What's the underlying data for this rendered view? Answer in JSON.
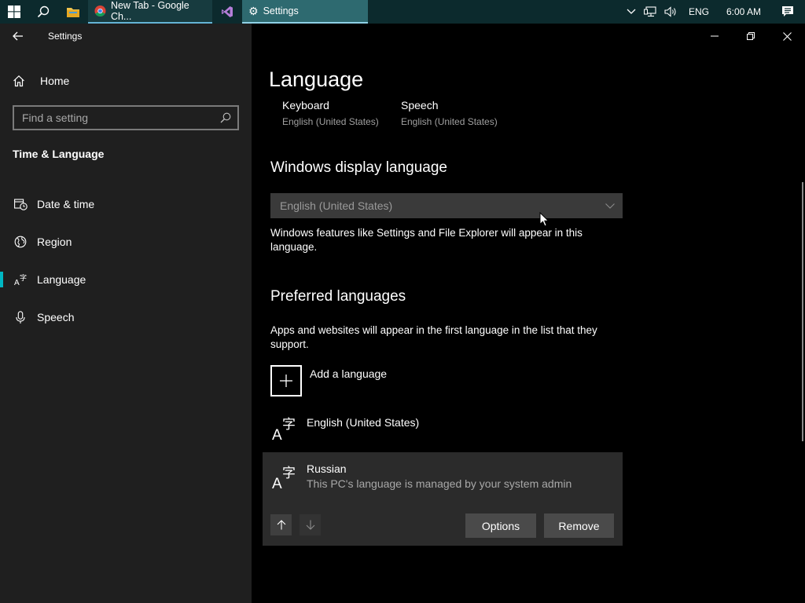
{
  "taskbar": {
    "chrome_label": "New Tab - Google Ch...",
    "settings_label": "Settings",
    "tray": {
      "language": "ENG",
      "time": "6:00 AM"
    }
  },
  "app": {
    "title": "Settings"
  },
  "nav": {
    "home_label": "Home",
    "section_title": "Time & Language",
    "items": [
      {
        "label": "Date & time",
        "icon": "calendar-clock-icon"
      },
      {
        "label": "Region",
        "icon": "globe-icon"
      },
      {
        "label": "Language",
        "icon": "language-icon",
        "active": true
      },
      {
        "label": "Speech",
        "icon": "microphone-icon"
      }
    ]
  },
  "search": {
    "placeholder": "Find a setting"
  },
  "page": {
    "title": "Language",
    "quick": {
      "keyboard": {
        "label": "Keyboard",
        "value": "English (United States)"
      },
      "speech": {
        "label": "Speech",
        "value": "English (United States)"
      }
    },
    "display_language": {
      "heading": "Windows display language",
      "selected": "English (United States)",
      "description": "Windows features like Settings and File Explorer will appear in this language."
    },
    "preferred": {
      "heading": "Preferred languages",
      "description": "Apps and websites will appear in the first language in the list that they support.",
      "add_label": "Add a language",
      "languages": [
        {
          "name": "English (United States)"
        },
        {
          "name": "Russian",
          "note": "This PC's language is managed by your system admin"
        }
      ],
      "options_label": "Options",
      "remove_label": "Remove"
    }
  },
  "colors": {
    "accent": "#00b7c3",
    "sidebar_bg": "#1f1f1f",
    "content_bg": "#000000",
    "taskbar_bg": "#0c2a2d"
  }
}
